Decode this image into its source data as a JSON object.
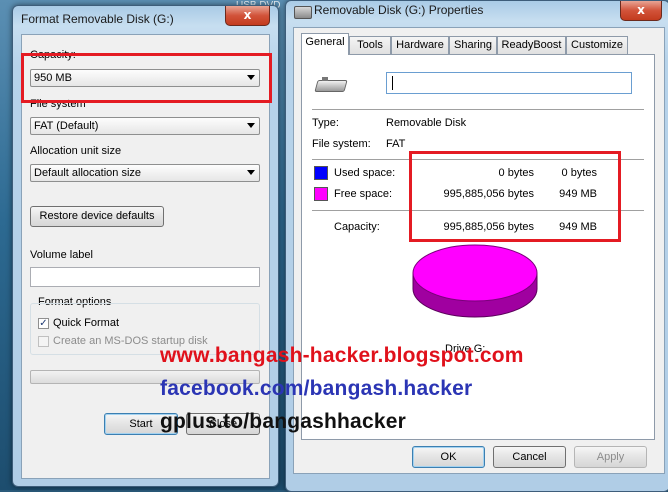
{
  "desktop": {
    "drive_label": "USB DVD"
  },
  "format_dialog": {
    "title": "Format Removable Disk (G:)",
    "close_glyph": "x",
    "capacity_label": "Capacity:",
    "capacity_value": "950 MB",
    "file_system_label": "File system",
    "file_system_value": "FAT (Default)",
    "allocation_label": "Allocation unit size",
    "allocation_value": "Default allocation size",
    "restore_button": "Restore device defaults",
    "volume_label": "Volume label",
    "volume_value": "",
    "format_options_label": "Format options",
    "quick_format_label": "Quick Format",
    "quick_format_checked": true,
    "msdos_label": "Create an MS-DOS startup disk",
    "msdos_checked": false,
    "start_button": "Start",
    "close_button": "Close"
  },
  "properties_dialog": {
    "title": "Removable Disk (G:) Properties",
    "close_glyph": "x",
    "tabs": [
      "General",
      "Tools",
      "Hardware",
      "Sharing",
      "ReadyBoost",
      "Customize"
    ],
    "active_tab": "General",
    "name_value": "",
    "type_label": "Type:",
    "type_value": "Removable Disk",
    "fs_label": "File system:",
    "fs_value": "FAT",
    "used_label": "Used space:",
    "used_bytes": "0 bytes",
    "used_size": "0 bytes",
    "free_label": "Free space:",
    "free_bytes": "995,885,056 bytes",
    "free_size": "949 MB",
    "capacity_label": "Capacity:",
    "capacity_bytes": "995,885,056 bytes",
    "capacity_size": "949 MB",
    "drive_label": "Drive G:",
    "ok_button": "OK",
    "cancel_button": "Cancel",
    "apply_button": "Apply",
    "colors": {
      "used": "#0000ff",
      "free": "#ff00ff",
      "free_shadow": "#a000a0"
    }
  },
  "overlay": {
    "line1": "www.bangash-hacker.blogspot.com",
    "line2": "facebook.com/bangash.hacker",
    "line3": "gplus.to/bangashhacker",
    "colors": {
      "line1": "#e0111b",
      "line2": "#2b35b4",
      "line3": "#111111"
    }
  }
}
